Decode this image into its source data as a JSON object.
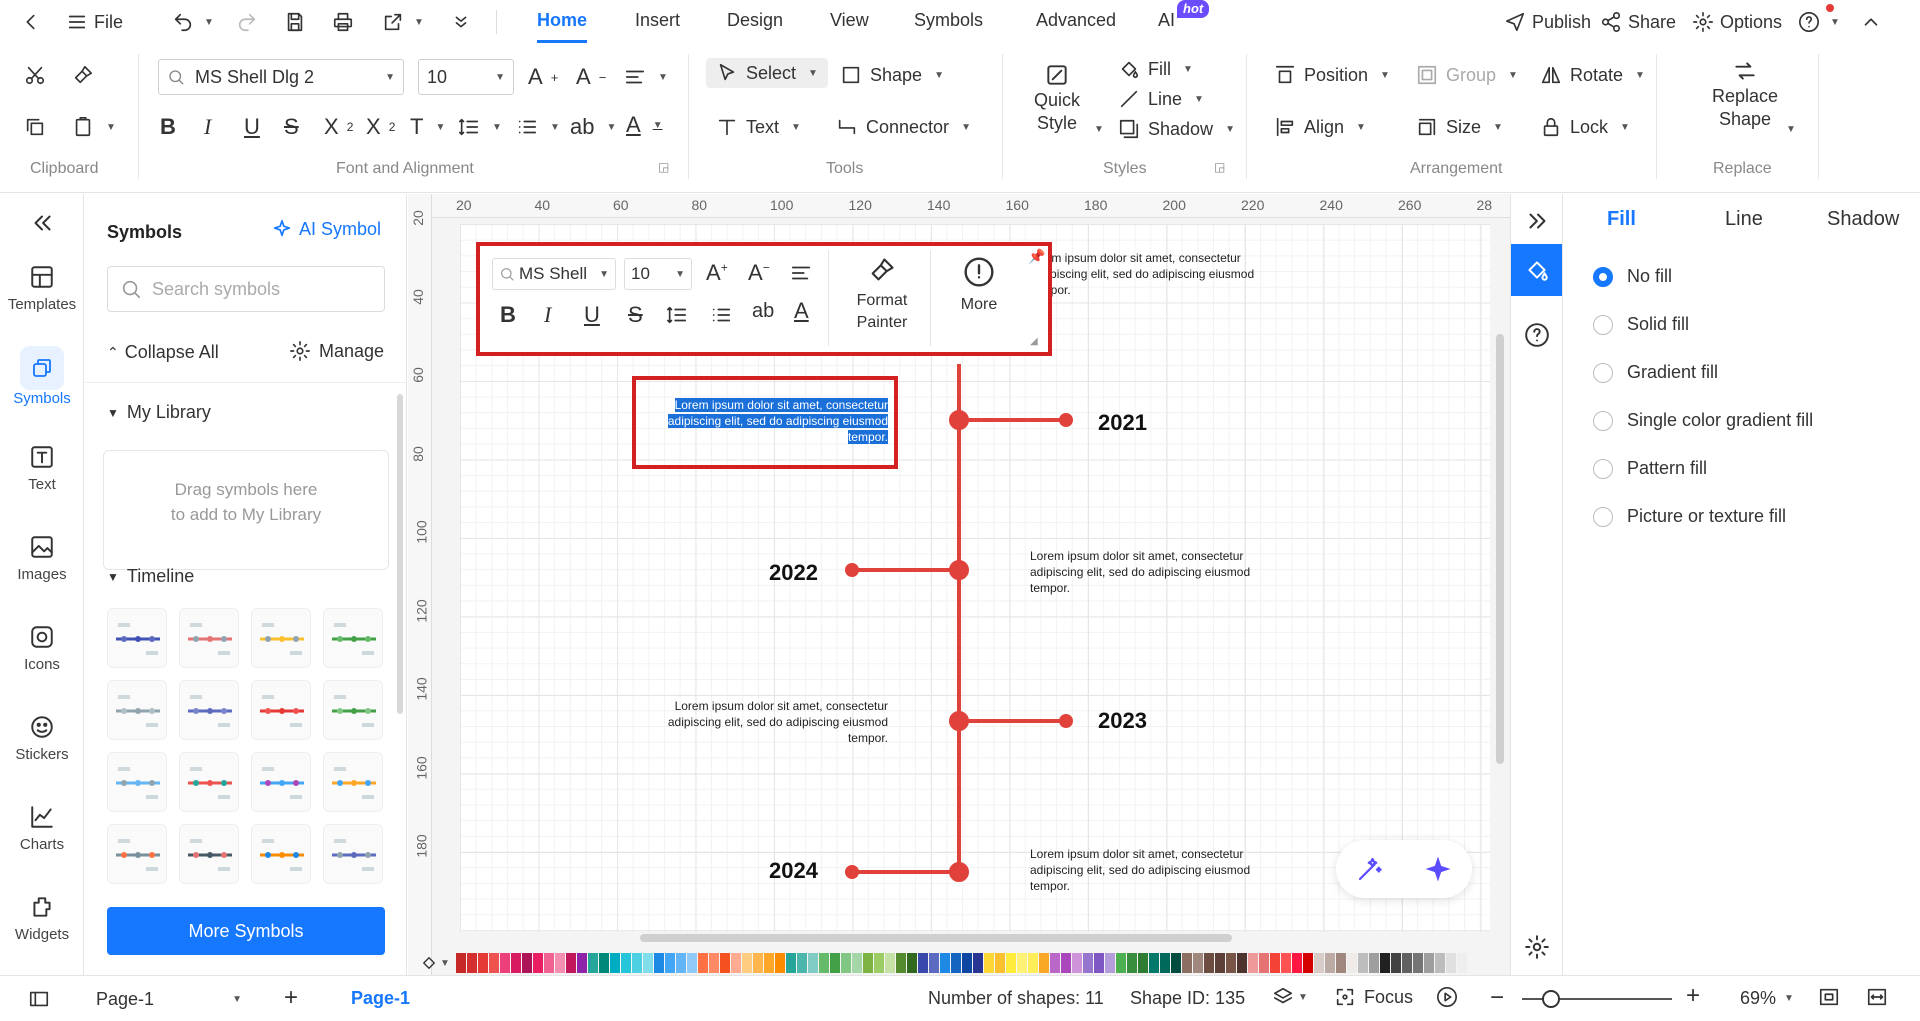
{
  "titlebar": {
    "file_label": "File",
    "tabs": [
      "Home",
      "Insert",
      "Design",
      "View",
      "Symbols",
      "Advanced",
      "AI"
    ],
    "ai_badge": "hot",
    "publish": "Publish",
    "share": "Share",
    "options": "Options"
  },
  "ribbon": {
    "font_name": "MS Shell Dlg 2",
    "font_size": "10",
    "select": "Select",
    "shape": "Shape",
    "text": "Text",
    "connector": "Connector",
    "quick_style_1": "Quick",
    "quick_style_2": "Style",
    "fill": "Fill",
    "line": "Line",
    "shadow": "Shadow",
    "position": "Position",
    "group": "Group",
    "rotate": "Rotate",
    "align": "Align",
    "size": "Size",
    "lock": "Lock",
    "replace_1": "Replace",
    "replace_2": "Shape",
    "groups": [
      "Clipboard",
      "Font and Alignment",
      "Tools",
      "Styles",
      "Arrangement",
      "Replace"
    ]
  },
  "rail": [
    {
      "label": "Templates",
      "icon": "templates-icon"
    },
    {
      "label": "Symbols",
      "icon": "symbols-icon",
      "active": true
    },
    {
      "label": "Text",
      "icon": "text-icon"
    },
    {
      "label": "Images",
      "icon": "images-icon"
    },
    {
      "label": "Icons",
      "icon": "icons-icon"
    },
    {
      "label": "Stickers",
      "icon": "stickers-icon"
    },
    {
      "label": "Charts",
      "icon": "charts-icon"
    },
    {
      "label": "Widgets",
      "icon": "widgets-icon"
    }
  ],
  "symbols": {
    "title": "Symbols",
    "ai_symbol": "AI Symbol",
    "search_placeholder": "Search symbols",
    "collapse_all": "Collapse All",
    "manage": "Manage",
    "my_library": "My Library",
    "drag_hint_1": "Drag symbols here",
    "drag_hint_2": "to add to My Library",
    "timeline": "Timeline",
    "more_symbols": "More Symbols"
  },
  "canvas": {
    "ruler_h": [
      "20",
      "40",
      "60",
      "80",
      "100",
      "120",
      "140",
      "160",
      "180",
      "200",
      "220",
      "240",
      "260",
      "28"
    ],
    "ruler_v": [
      "20",
      "40",
      "60",
      "80",
      "100",
      "120",
      "140",
      "160",
      "180"
    ],
    "floating_toolbar": {
      "font": "MS Shell [",
      "size": "10",
      "format_painter_1": "Format",
      "format_painter_2": "Painter",
      "more": "More"
    },
    "lorem_1": "Lorem ipsum dolor sit amet, consectetur",
    "lorem_2": "adipiscing elit, sed do adipiscing eiusmod",
    "lorem_3": "tempor.",
    "lorem_top_2": "adipiscing elit, sed do adipiscing eiusmod",
    "lorem_top_1": "orem ipsum dolor sit amet, consectetur",
    "lorem_top_3": "empor.",
    "years": [
      "2021",
      "2022",
      "2023",
      "2024"
    ]
  },
  "props": {
    "tabs": [
      "Fill",
      "Line",
      "Shadow"
    ],
    "options": [
      "No fill",
      "Solid fill",
      "Gradient fill",
      "Single color gradient fill",
      "Pattern fill",
      "Picture or texture fill"
    ]
  },
  "status": {
    "page_select": "Page-1",
    "page_tab": "Page-1",
    "shapes": "Number of shapes: 11",
    "shape_id": "Shape ID: 135",
    "focus": "Focus",
    "zoom": "69%"
  },
  "palette": [
    "#c62828",
    "#d32f2f",
    "#e53935",
    "#ef5350",
    "#ec407a",
    "#d81b60",
    "#ad1457",
    "#e91e63",
    "#f06292",
    "#f48fb1",
    "#c2185b",
    "#8e24aa",
    "#26a69a",
    "#00897b",
    "#00acc1",
    "#26c6da",
    "#4dd0e1",
    "#80deea",
    "#1e88e5",
    "#42a5f5",
    "#64b5f6",
    "#90caf9",
    "#ff7043",
    "#ff8a65",
    "#f4511e",
    "#ffab91",
    "#ffcc80",
    "#ffb74d",
    "#ffa726",
    "#fb8c00",
    "#26a69a",
    "#4db6ac",
    "#80cbc4",
    "#66bb6a",
    "#43a047",
    "#81c784",
    "#a5d6a7",
    "#7cb342",
    "#9ccc65",
    "#c5e1a5",
    "#558b2f",
    "#33691e",
    "#3949ab",
    "#5c6bc0",
    "#1e88e5",
    "#1565c0",
    "#0d47a1",
    "#283593",
    "#fdd835",
    "#fbc02d",
    "#ffeb3b",
    "#fff176",
    "#ffee58",
    "#f9a825",
    "#ba68c8",
    "#ab47bc",
    "#ce93d8",
    "#9575cd",
    "#7e57c2",
    "#b39ddb",
    "#4caf50",
    "#388e3c",
    "#2e7d32",
    "#00796b",
    "#00695c",
    "#004d40",
    "#8d6e63",
    "#a1887f",
    "#6d4c41",
    "#5d4037",
    "#795548",
    "#4e342e",
    "#ef9a9a",
    "#e57373",
    "#f44336",
    "#ff5252",
    "#ff1744",
    "#d50000",
    "#d7ccc8",
    "#bcaaa4",
    "#a1887f",
    "#efebe9",
    "#bdbdbd",
    "#9e9e9e",
    "#212121",
    "#424242",
    "#616161",
    "#757575",
    "#9e9e9e",
    "#bdbdbd",
    "#e0e0e0",
    "#eeeeee"
  ]
}
